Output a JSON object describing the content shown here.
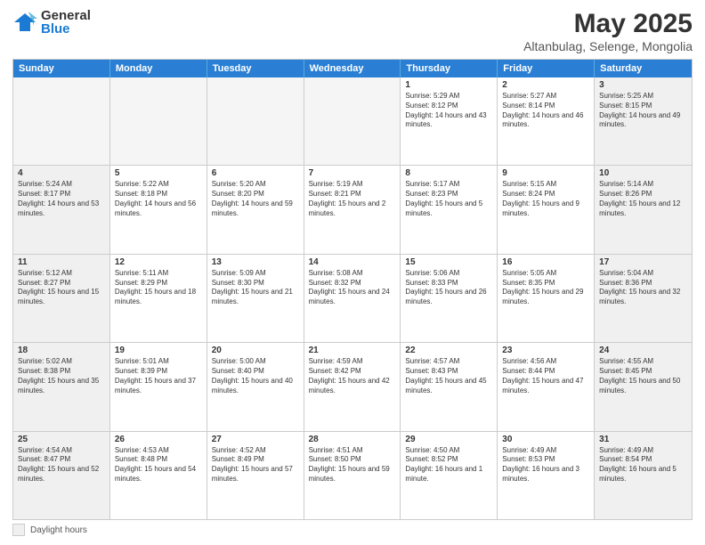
{
  "logo": {
    "general": "General",
    "blue": "Blue"
  },
  "title": "May 2025",
  "subtitle": "Altanbulag, Selenge, Mongolia",
  "weekdays": [
    "Sunday",
    "Monday",
    "Tuesday",
    "Wednesday",
    "Thursday",
    "Friday",
    "Saturday"
  ],
  "weeks": [
    [
      {
        "day": "",
        "empty": true
      },
      {
        "day": "",
        "empty": true
      },
      {
        "day": "",
        "empty": true
      },
      {
        "day": "",
        "empty": true
      },
      {
        "day": "1",
        "rise": "5:29 AM",
        "set": "8:12 PM",
        "daylight": "14 hours and 43 minutes."
      },
      {
        "day": "2",
        "rise": "5:27 AM",
        "set": "8:14 PM",
        "daylight": "14 hours and 46 minutes."
      },
      {
        "day": "3",
        "rise": "5:25 AM",
        "set": "8:15 PM",
        "daylight": "14 hours and 49 minutes."
      }
    ],
    [
      {
        "day": "4",
        "rise": "5:24 AM",
        "set": "8:17 PM",
        "daylight": "14 hours and 53 minutes."
      },
      {
        "day": "5",
        "rise": "5:22 AM",
        "set": "8:18 PM",
        "daylight": "14 hours and 56 minutes."
      },
      {
        "day": "6",
        "rise": "5:20 AM",
        "set": "8:20 PM",
        "daylight": "14 hours and 59 minutes."
      },
      {
        "day": "7",
        "rise": "5:19 AM",
        "set": "8:21 PM",
        "daylight": "15 hours and 2 minutes."
      },
      {
        "day": "8",
        "rise": "5:17 AM",
        "set": "8:23 PM",
        "daylight": "15 hours and 5 minutes."
      },
      {
        "day": "9",
        "rise": "5:15 AM",
        "set": "8:24 PM",
        "daylight": "15 hours and 9 minutes."
      },
      {
        "day": "10",
        "rise": "5:14 AM",
        "set": "8:26 PM",
        "daylight": "15 hours and 12 minutes."
      }
    ],
    [
      {
        "day": "11",
        "rise": "5:12 AM",
        "set": "8:27 PM",
        "daylight": "15 hours and 15 minutes."
      },
      {
        "day": "12",
        "rise": "5:11 AM",
        "set": "8:29 PM",
        "daylight": "15 hours and 18 minutes."
      },
      {
        "day": "13",
        "rise": "5:09 AM",
        "set": "8:30 PM",
        "daylight": "15 hours and 21 minutes."
      },
      {
        "day": "14",
        "rise": "5:08 AM",
        "set": "8:32 PM",
        "daylight": "15 hours and 24 minutes."
      },
      {
        "day": "15",
        "rise": "5:06 AM",
        "set": "8:33 PM",
        "daylight": "15 hours and 26 minutes."
      },
      {
        "day": "16",
        "rise": "5:05 AM",
        "set": "8:35 PM",
        "daylight": "15 hours and 29 minutes."
      },
      {
        "day": "17",
        "rise": "5:04 AM",
        "set": "8:36 PM",
        "daylight": "15 hours and 32 minutes."
      }
    ],
    [
      {
        "day": "18",
        "rise": "5:02 AM",
        "set": "8:38 PM",
        "daylight": "15 hours and 35 minutes."
      },
      {
        "day": "19",
        "rise": "5:01 AM",
        "set": "8:39 PM",
        "daylight": "15 hours and 37 minutes."
      },
      {
        "day": "20",
        "rise": "5:00 AM",
        "set": "8:40 PM",
        "daylight": "15 hours and 40 minutes."
      },
      {
        "day": "21",
        "rise": "4:59 AM",
        "set": "8:42 PM",
        "daylight": "15 hours and 42 minutes."
      },
      {
        "day": "22",
        "rise": "4:57 AM",
        "set": "8:43 PM",
        "daylight": "15 hours and 45 minutes."
      },
      {
        "day": "23",
        "rise": "4:56 AM",
        "set": "8:44 PM",
        "daylight": "15 hours and 47 minutes."
      },
      {
        "day": "24",
        "rise": "4:55 AM",
        "set": "8:45 PM",
        "daylight": "15 hours and 50 minutes."
      }
    ],
    [
      {
        "day": "25",
        "rise": "4:54 AM",
        "set": "8:47 PM",
        "daylight": "15 hours and 52 minutes."
      },
      {
        "day": "26",
        "rise": "4:53 AM",
        "set": "8:48 PM",
        "daylight": "15 hours and 54 minutes."
      },
      {
        "day": "27",
        "rise": "4:52 AM",
        "set": "8:49 PM",
        "daylight": "15 hours and 57 minutes."
      },
      {
        "day": "28",
        "rise": "4:51 AM",
        "set": "8:50 PM",
        "daylight": "15 hours and 59 minutes."
      },
      {
        "day": "29",
        "rise": "4:50 AM",
        "set": "8:52 PM",
        "daylight": "16 hours and 1 minute."
      },
      {
        "day": "30",
        "rise": "4:49 AM",
        "set": "8:53 PM",
        "daylight": "16 hours and 3 minutes."
      },
      {
        "day": "31",
        "rise": "4:49 AM",
        "set": "8:54 PM",
        "daylight": "16 hours and 5 minutes."
      }
    ]
  ],
  "footer": {
    "daylight_label": "Daylight hours"
  }
}
